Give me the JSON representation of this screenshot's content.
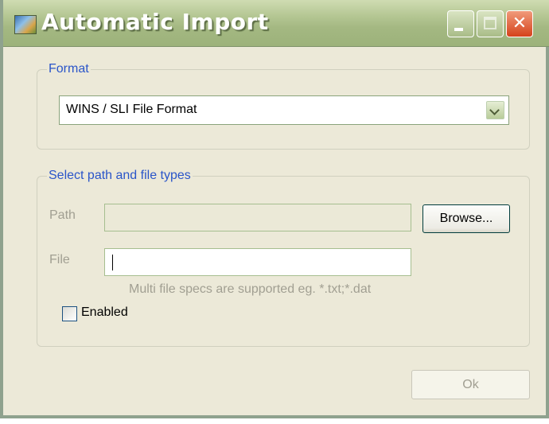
{
  "window": {
    "title": "Automatic Import",
    "icon": "app-icon",
    "controls": {
      "minimize": "minimize-icon",
      "maximize": "maximize-icon",
      "close": "close-icon"
    }
  },
  "format_group": {
    "legend": "Format",
    "select": {
      "value": "WINS / SLI File Format",
      "icon": "chevron-down-icon"
    }
  },
  "path_group": {
    "legend": "Select path and file types",
    "path": {
      "label": "Path",
      "value": ""
    },
    "browse_label": "Browse...",
    "file": {
      "label": "File",
      "value": ""
    },
    "hint": "Multi file specs are supported eg. *.txt;*.dat",
    "enabled": {
      "label": "Enabled",
      "checked": false
    }
  },
  "ok_label": "Ok",
  "colors": {
    "legend": "#2a55c9",
    "disabled_text": "#a19f92",
    "titlebar": "#a4b882",
    "close": "#d5421c"
  }
}
